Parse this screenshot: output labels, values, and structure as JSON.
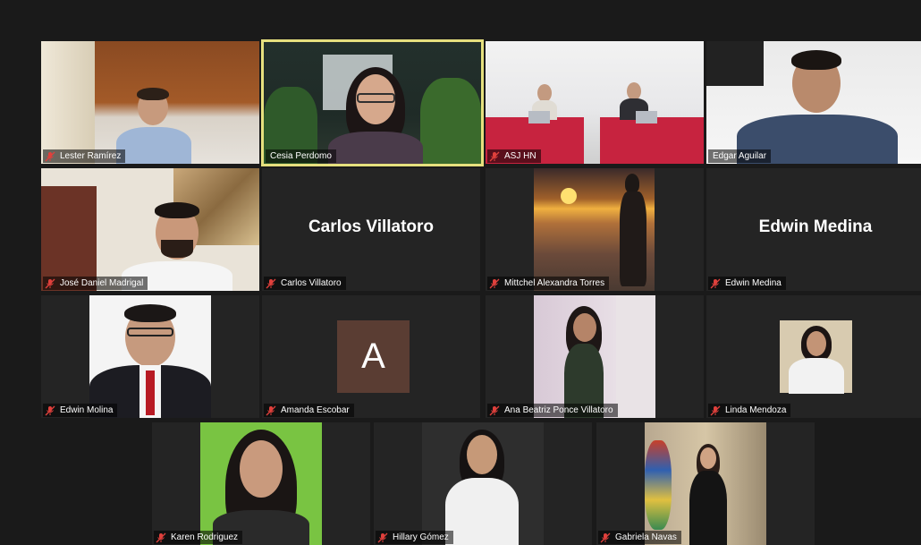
{
  "participants": [
    {
      "name": "Lester Ramírez"
    },
    {
      "name": "Cesia Perdomo"
    },
    {
      "name": "ASJ HN"
    },
    {
      "name": "Edgar Aguilar"
    },
    {
      "name": "José Daniel Madrigal"
    },
    {
      "name": "Carlos Villatoro",
      "display_name": "Carlos Villatoro"
    },
    {
      "name": "Mittchel Alexandra Torres"
    },
    {
      "name": "Edwin Medina",
      "display_name": "Edwin Medina"
    },
    {
      "name": "Edwin Molina"
    },
    {
      "name": "Amanda Escobar",
      "avatar_letter": "A"
    },
    {
      "name": "Ana Beatriz Ponce Villatoro"
    },
    {
      "name": "Linda Mendoza"
    },
    {
      "name": "Karen Rodriguez"
    },
    {
      "name": "Hillary Gómez"
    },
    {
      "name": "Gabriela Navas"
    }
  ],
  "colors": {
    "active_speaker_border": "#e6e07e",
    "tile_background": "#242424",
    "muted_mic": "#e0403c",
    "avatar": "#5a3d33"
  },
  "icons": {
    "mic": "muted-microphone-icon"
  }
}
